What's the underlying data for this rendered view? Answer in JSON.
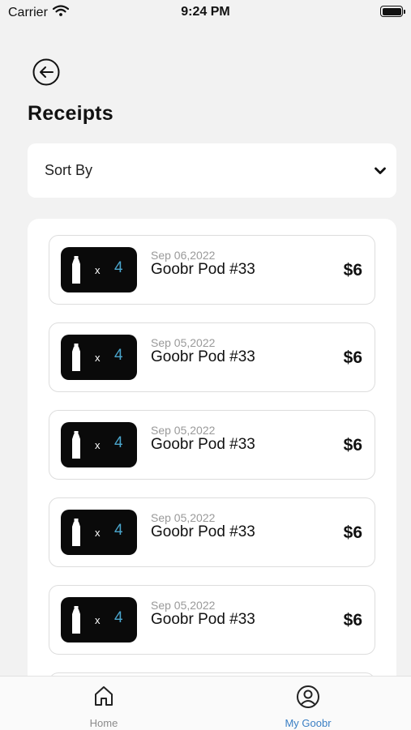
{
  "status_bar": {
    "carrier": "Carrier",
    "time": "9:24 PM"
  },
  "header": {
    "title": "Receipts",
    "back_icon": "arrow-left-circle-icon"
  },
  "sort": {
    "label": "Sort By",
    "icon": "chevron-down-icon"
  },
  "receipts": [
    {
      "date": "Sep 06,2022",
      "name": "Goobr Pod #33",
      "price": "$6",
      "multiplier": "x",
      "quantity": "4"
    },
    {
      "date": "Sep 05,2022",
      "name": "Goobr Pod #33",
      "price": "$6",
      "multiplier": "x",
      "quantity": "4"
    },
    {
      "date": "Sep 05,2022",
      "name": "Goobr Pod #33",
      "price": "$6",
      "multiplier": "x",
      "quantity": "4"
    },
    {
      "date": "Sep 05,2022",
      "name": "Goobr Pod #33",
      "price": "$6",
      "multiplier": "x",
      "quantity": "4"
    },
    {
      "date": "Sep 05,2022",
      "name": "Goobr Pod #33",
      "price": "$6",
      "multiplier": "x",
      "quantity": "4"
    }
  ],
  "tab_bar": {
    "home": {
      "label": "Home",
      "icon": "home-icon"
    },
    "my_goobr": {
      "label": "My Goobr",
      "icon": "user-circle-icon"
    }
  },
  "colors": {
    "accent": "#3a7fc4",
    "quantity": "#4aa5cc",
    "background": "#f2f2f2"
  }
}
